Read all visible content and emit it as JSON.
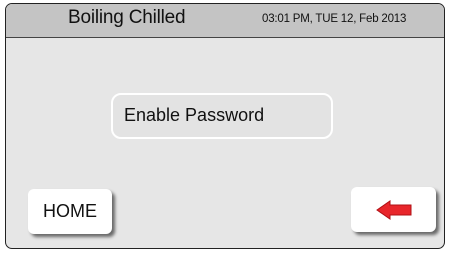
{
  "header": {
    "title": "Boiling Chilled",
    "datetime": "03:01 PM, TUE 12, Feb 2013"
  },
  "main": {
    "password_button_label": "Enable Password"
  },
  "footer": {
    "home_label": "HOME",
    "back_icon": "left-arrow-icon"
  },
  "colors": {
    "header_bg": "#c4c4c4",
    "screen_bg": "#e6e6e6",
    "button_bg": "#ffffff",
    "arrow": "#e8262b"
  }
}
